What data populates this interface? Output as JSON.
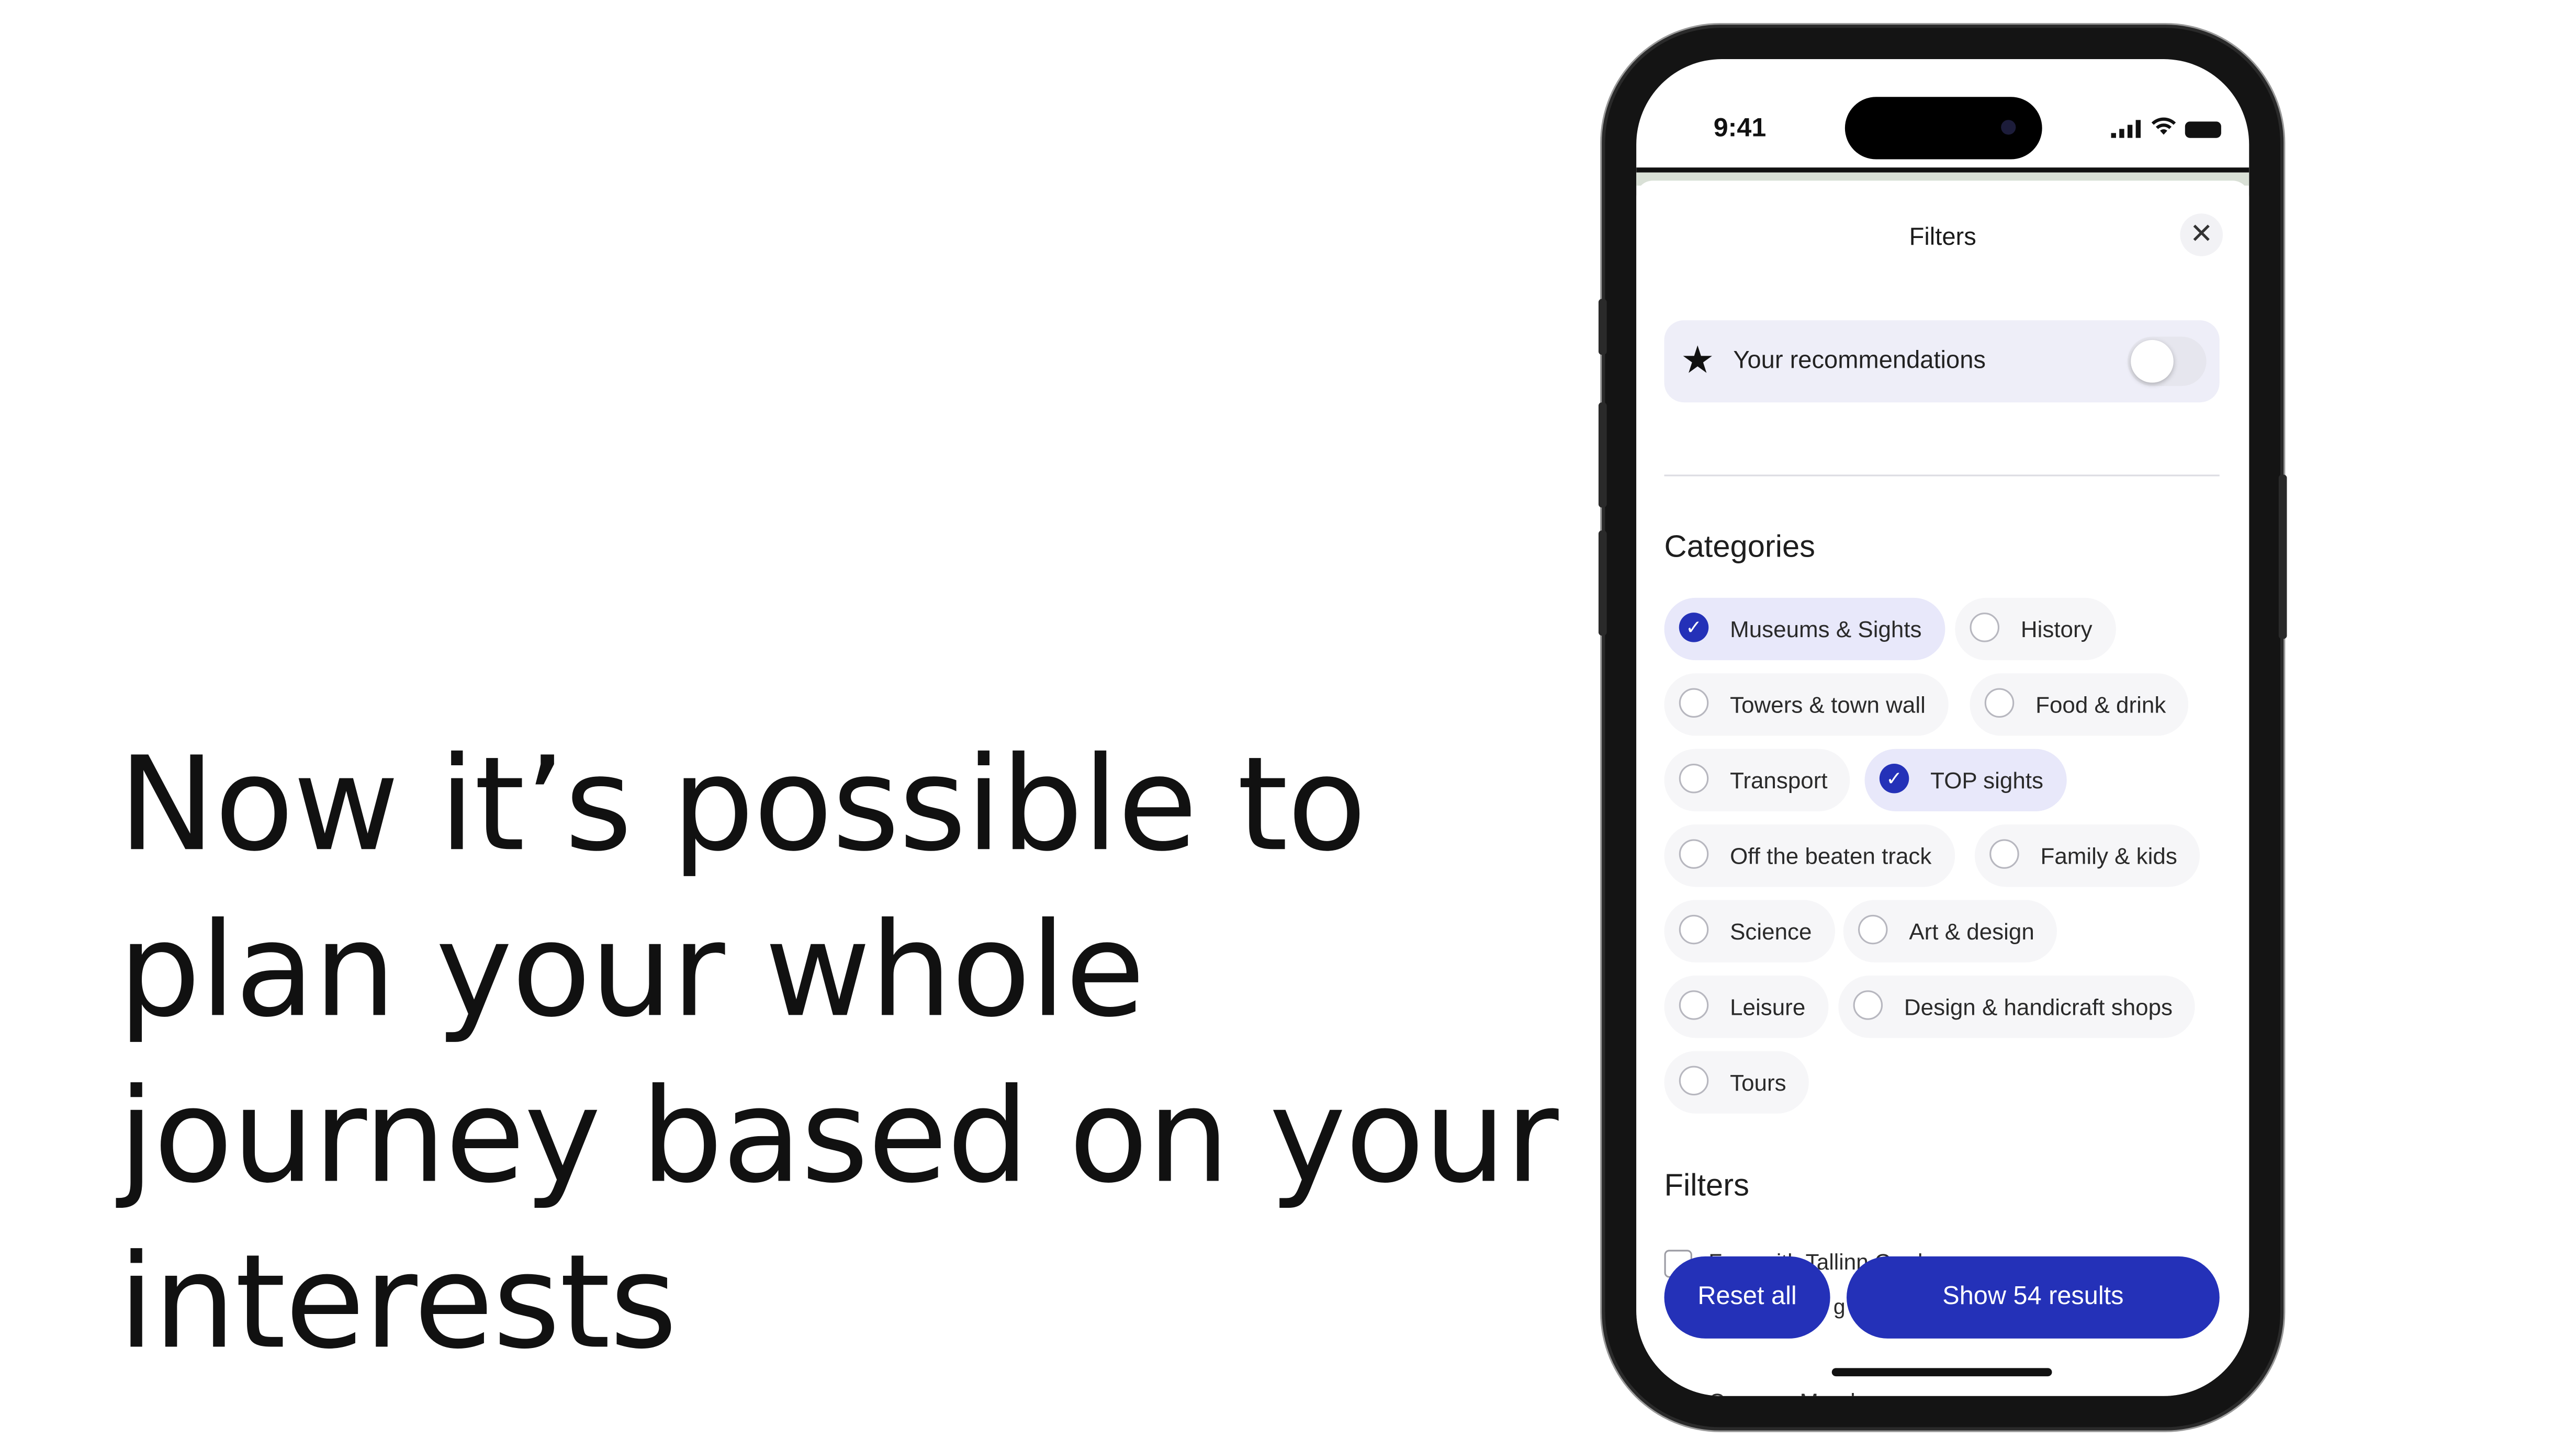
{
  "headline": "Now it’s possible to plan your whole journey based on your interests",
  "status_bar": {
    "time": "9:41"
  },
  "sheet": {
    "title": "Filters",
    "close_icon": "close-icon",
    "recommendations": {
      "icon": "star-icon",
      "label": "Your recommendations",
      "enabled": false
    },
    "categories_title": "Categories",
    "categories": [
      {
        "label": "Museums & Sights",
        "selected": true
      },
      {
        "label": "History",
        "selected": false
      },
      {
        "label": "Towers & town wall",
        "selected": false
      },
      {
        "label": "Food & drink",
        "selected": false
      },
      {
        "label": "Transport",
        "selected": false
      },
      {
        "label": "TOP sights",
        "selected": true
      },
      {
        "label": "Off the beaten track",
        "selected": false
      },
      {
        "label": "Family & kids",
        "selected": false
      },
      {
        "label": "Science",
        "selected": false
      },
      {
        "label": "Art & design",
        "selected": false
      },
      {
        "label": "Leisure",
        "selected": false
      },
      {
        "label": "Design & handicraft shops",
        "selected": false
      },
      {
        "label": "Tours",
        "selected": false
      }
    ],
    "filters_title": "Filters",
    "filters": [
      {
        "label": "Free with Tallinn Card",
        "checked": false
      },
      {
        "label": "Open on Mondays",
        "checked": false
      }
    ],
    "hidden_fragment": "g",
    "reset_label": "Reset all",
    "show_label": "Show 54 results"
  },
  "colors": {
    "accent": "#2431b8",
    "chip_selected_bg": "#e8e8fa",
    "chip_bg": "#f6f6f8",
    "rec_card_bg": "#eeeef8"
  }
}
